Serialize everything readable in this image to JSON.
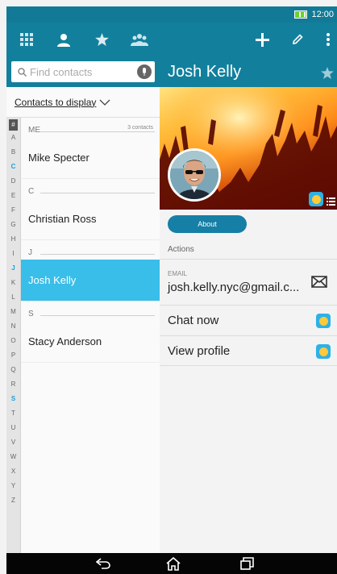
{
  "status_bar": {
    "time": "12:00",
    "battery_icon": "battery-charging-icon"
  },
  "action_bar": {
    "icons": [
      "grid-icon",
      "person-icon",
      "star-icon",
      "groups-icon",
      "add-icon",
      "edit-icon",
      "overflow-menu-icon"
    ]
  },
  "search": {
    "placeholder": "Find contacts",
    "icon": "search-icon",
    "voice_icon": "microphone-icon"
  },
  "display_filter": {
    "label": "Contacts to display",
    "icon": "chevron-down-icon"
  },
  "alpha_index": [
    "#",
    "A",
    "B",
    "C",
    "D",
    "E",
    "F",
    "G",
    "H",
    "I",
    "J",
    "K",
    "L",
    "M",
    "N",
    "O",
    "P",
    "Q",
    "R",
    "S",
    "T",
    "U",
    "V",
    "W",
    "X",
    "Y",
    "Z"
  ],
  "alpha_active": [
    "C",
    "J",
    "S"
  ],
  "sections": [
    {
      "header": "ME",
      "count": "3 contacts",
      "contacts": [
        {
          "name": "Mike Specter",
          "selected": false
        }
      ]
    },
    {
      "header": "C",
      "count": "",
      "contacts": [
        {
          "name": "Christian Ross",
          "selected": false
        }
      ]
    },
    {
      "header": "J",
      "count": "",
      "contacts": [
        {
          "name": "Josh Kelly",
          "selected": true
        }
      ]
    },
    {
      "header": "S",
      "count": "",
      "contacts": [
        {
          "name": "Stacy Anderson",
          "selected": false
        }
      ]
    }
  ],
  "detail": {
    "name": "Josh Kelly",
    "favorite_icon": "star-icon",
    "about_label": "About",
    "actions_label": "Actions",
    "email_label": "EMAIL",
    "email_value": "josh.kelly.nyc@gmail.c...",
    "email_icon": "mail-icon",
    "chat_label": "Chat now",
    "profile_label": "View profile",
    "app_icon": "messenger-app-icon"
  },
  "nav_bar": {
    "icons": [
      "back-icon",
      "home-icon",
      "recents-icon"
    ]
  },
  "colors": {
    "primary": "#12809d",
    "status_bar": "#127a96",
    "selected": "#39bde9",
    "about_button": "#167fa6",
    "active_letter": "#1aa0d8"
  }
}
